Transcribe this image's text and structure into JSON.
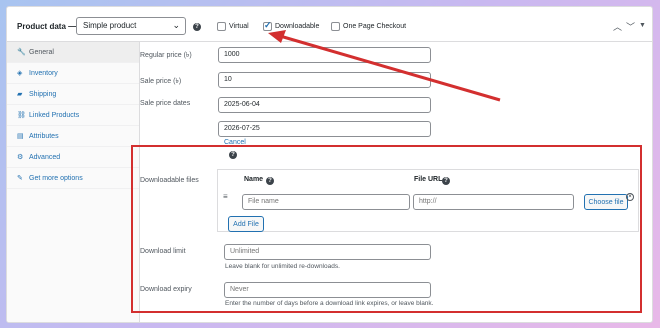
{
  "header": {
    "title": "Product data —",
    "product_type": "Simple product",
    "virtual_label": "Virtual",
    "downloadable_label": "Downloadable",
    "one_page_label": "One Page Checkout"
  },
  "sidebar": {
    "items": [
      {
        "label": "General"
      },
      {
        "label": "Inventory"
      },
      {
        "label": "Shipping"
      },
      {
        "label": "Linked Products"
      },
      {
        "label": "Attributes"
      },
      {
        "label": "Advanced"
      },
      {
        "label": "Get more options"
      }
    ]
  },
  "general": {
    "regular_price_label": "Regular price (৳)",
    "regular_price": "1000",
    "sale_price_label": "Sale price (৳)",
    "sale_price": "10",
    "sale_dates_label": "Sale price dates",
    "date_from": "2025-06-04",
    "date_to": "2026-07-25",
    "cancel": "Cancel"
  },
  "downloads": {
    "files_label": "Downloadable files",
    "col_name": "Name",
    "col_url": "File URL",
    "name_placeholder": "File name",
    "url_placeholder": "http://",
    "choose_file": "Choose file",
    "add_file": "Add File",
    "limit_label": "Download limit",
    "limit_placeholder": "Unlimited",
    "limit_hint": "Leave blank for unlimited re-downloads.",
    "expiry_label": "Download expiry",
    "expiry_placeholder": "Never",
    "expiry_hint": "Enter the number of days before a download link expires, or leave blank."
  },
  "colors": {
    "accent": "#2271b1",
    "highlight": "#d32f2f"
  },
  "icons": [
    "wrench-icon",
    "inventory-icon",
    "truck-icon",
    "link-icon",
    "list-icon",
    "gear-icon",
    "plug-icon",
    "help-icon",
    "chevron-up-icon",
    "chevron-down-icon",
    "triangle-icon",
    "drag-icon",
    "remove-icon"
  ]
}
